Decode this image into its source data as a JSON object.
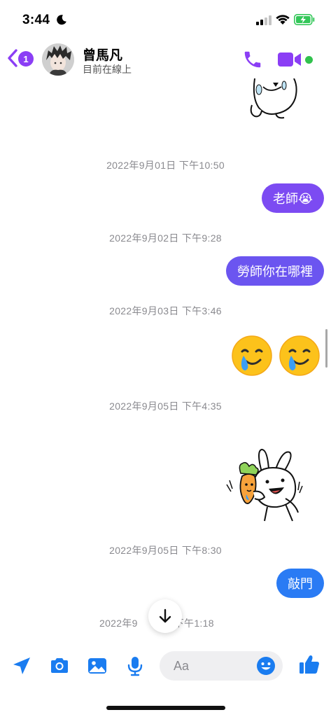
{
  "status_bar": {
    "time": "3:44"
  },
  "header": {
    "back_badge": "1",
    "contact_name": "曾馬凡",
    "contact_status": "目前在線上"
  },
  "messages": {
    "ts1": "2022年9月01日 下午10:50",
    "msg1": "老師😭",
    "ts2": "2022年9月02日 下午9:28",
    "msg2": "勞師你在哪裡",
    "ts3": "2022年9月03日 下午3:46",
    "ts4": "2022年9月05日 下午4:35",
    "ts5": "2022年9月05日 下午8:30",
    "msg5": "敲門",
    "ts6": "2022年9",
    "ts6_time": "下午1:18"
  },
  "composer": {
    "placeholder": "Aa"
  },
  "colors": {
    "accent_purple": "#8b3ef5",
    "bubble_purple": "#7c4bf2",
    "bubble_blue": "#2a7bf4",
    "online_green": "#31c24d",
    "toolbar_blue": "#1a7cf0"
  }
}
